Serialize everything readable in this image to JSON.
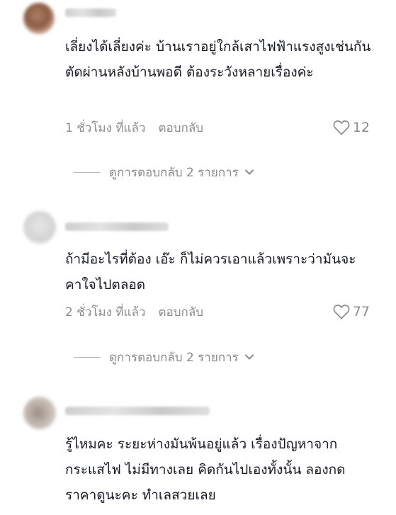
{
  "comments": [
    {
      "text": "เลี่ยงได้เลี่ยงค่ะ บ้านเราอยู่ใกล้เสาไฟฟ้าแรงสูงเช่นกันตัดผ่านหลังบ้านพอดี ต้องระวังหลายเรื่องค่ะ",
      "time": "1 ชั่วโมง ที่แล้ว",
      "reply_label": "ตอบกลับ",
      "likes": "12",
      "view_replies": "ดูการตอบกลับ 2 รายการ"
    },
    {
      "text": "ถ้ามีอะไรที่ต้อง เอ๊ะ ก็ไม่ควรเอาแล้วเพราะว่ามันจะคาใจไปตลอด",
      "time": "2 ชั่วโมง ที่แล้ว",
      "reply_label": "ตอบกลับ",
      "likes": "77",
      "view_replies": "ดูการตอบกลับ 2 รายการ"
    },
    {
      "text": "รู้ไหมคะ ระยะห่างมันพ้นอยู่แล้ว เรื่องปัญหาจากกระแสไฟ ไม่มีทางเลย คิดกันไปเองทั้งนั้น ลองกดราคาดูนะคะ ทำเลสวยเลย"
    }
  ],
  "icons": {
    "like": "heart-outline-icon",
    "expand": "chevron-down-icon"
  },
  "colors": {
    "text": "#161823",
    "muted": "#8a8b91"
  }
}
